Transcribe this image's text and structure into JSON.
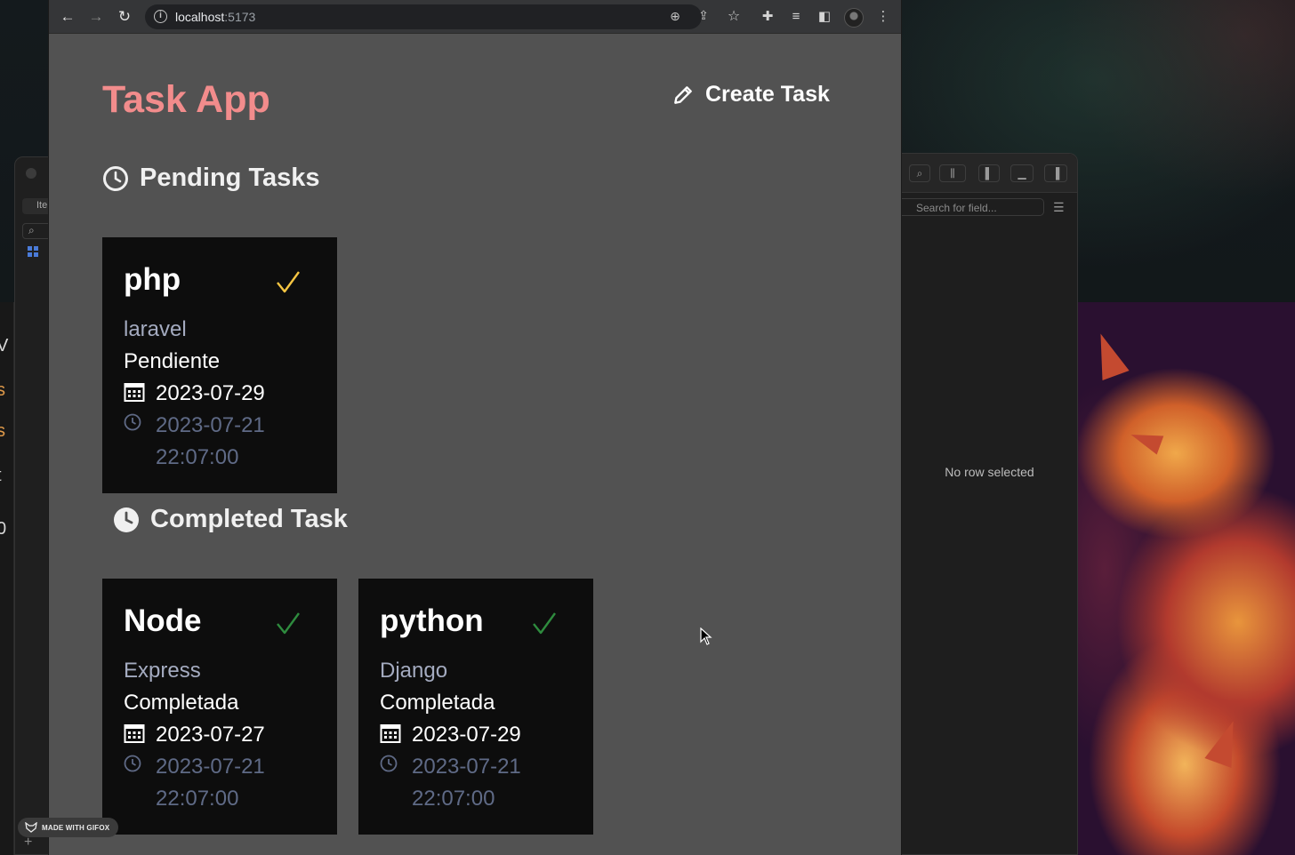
{
  "browser": {
    "url_host": "localhost",
    "url_port": ":5173"
  },
  "app": {
    "title": "Task App",
    "create_label": "Create Task"
  },
  "sections": {
    "pending_title": "Pending Tasks",
    "completed_title": "Completed Task"
  },
  "pending_tasks": [
    {
      "name": "php",
      "description": "laravel",
      "status": "Pendiente",
      "due": "2023-07-29",
      "created_date": "2023-07-21",
      "created_time": "22:07:00",
      "check_color": "#f5c542"
    }
  ],
  "completed_tasks": [
    {
      "name": "Node",
      "description": "Express",
      "status": "Completada",
      "due": "2023-07-27",
      "created_date": "2023-07-21",
      "created_time": "22:07:00",
      "check_color": "#2e8b3e"
    },
    {
      "name": "python",
      "description": "Django",
      "status": "Completada",
      "due": "2023-07-29",
      "created_date": "2023-07-21",
      "created_time": "22:07:00",
      "check_color": "#2e8b3e"
    }
  ],
  "side_app": {
    "search_placeholder": "Search for field...",
    "empty_text": "No row selected",
    "tab_partial": "Ite"
  },
  "overlay": {
    "gifox_label": "MADE WITH GIFOX"
  },
  "colors": {
    "title": "#f28c8c",
    "card_bg": "#0d0d0d",
    "page_bg": "#525252"
  }
}
